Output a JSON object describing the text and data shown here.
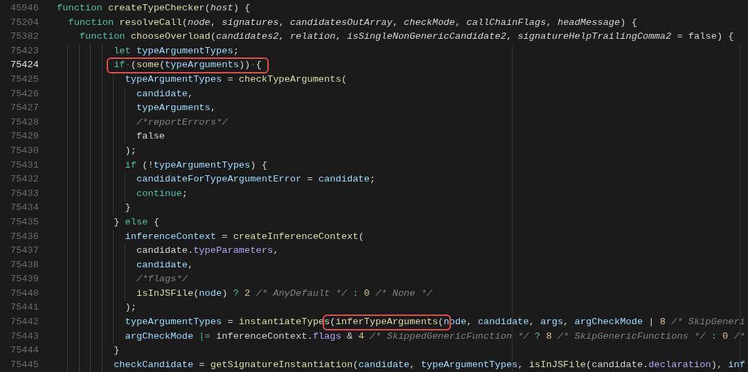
{
  "editor": {
    "lines": [
      {
        "number": "45946",
        "active": false,
        "sticky": true,
        "tokens": [
          {
            "kind": "kw",
            "text": "function "
          },
          {
            "kind": "fn",
            "text": "createTypeChecker"
          },
          {
            "kind": "plain",
            "text": "("
          },
          {
            "kind": "param",
            "text": "host"
          },
          {
            "kind": "plain",
            "text": ") {"
          }
        ]
      },
      {
        "number": "75204",
        "active": false,
        "sticky": true,
        "tokens": [
          {
            "kind": "kw",
            "text": "  function "
          },
          {
            "kind": "fn",
            "text": "resolveCall"
          },
          {
            "kind": "plain",
            "text": "("
          },
          {
            "kind": "param",
            "text": "node"
          },
          {
            "kind": "plain",
            "text": ", "
          },
          {
            "kind": "param",
            "text": "signatures"
          },
          {
            "kind": "plain",
            "text": ", "
          },
          {
            "kind": "param",
            "text": "candidatesOutArray"
          },
          {
            "kind": "plain",
            "text": ", "
          },
          {
            "kind": "param",
            "text": "checkMode"
          },
          {
            "kind": "plain",
            "text": ", "
          },
          {
            "kind": "param",
            "text": "callChainFlags"
          },
          {
            "kind": "plain",
            "text": ", "
          },
          {
            "kind": "param",
            "text": "headMessage"
          },
          {
            "kind": "plain",
            "text": ") {"
          }
        ]
      },
      {
        "number": "75382",
        "active": false,
        "sticky": true,
        "tokens": [
          {
            "kind": "kw",
            "text": "    function "
          },
          {
            "kind": "fn",
            "text": "chooseOverload"
          },
          {
            "kind": "plain",
            "text": "("
          },
          {
            "kind": "param",
            "text": "candidates2"
          },
          {
            "kind": "plain",
            "text": ", "
          },
          {
            "kind": "param",
            "text": "relation"
          },
          {
            "kind": "plain",
            "text": ", "
          },
          {
            "kind": "param",
            "text": "isSingleNonGenericCandidate2"
          },
          {
            "kind": "plain",
            "text": ", "
          },
          {
            "kind": "param",
            "text": "signatureHelpTrailingComma2"
          },
          {
            "kind": "plain",
            "text": " = false) {"
          }
        ]
      },
      {
        "number": "75423",
        "active": false,
        "sticky": false,
        "tokens": [
          {
            "kind": "kw",
            "text": "          let "
          },
          {
            "kind": "var",
            "text": "typeArgumentTypes"
          },
          {
            "kind": "plain",
            "text": ";"
          }
        ]
      },
      {
        "number": "75424",
        "active": true,
        "sticky": false,
        "tokens": [
          {
            "kind": "group",
            "boxed": true,
            "tokens": [
              {
                "kind": "kw",
                "text": "          if"
              },
              {
                "kind": "ws",
                "text": "·"
              },
              {
                "kind": "plain",
                "text": "("
              },
              {
                "kind": "fn",
                "text": "some"
              },
              {
                "kind": "plain",
                "text": "("
              },
              {
                "kind": "var",
                "text": "typeArguments"
              },
              {
                "kind": "plain",
                "text": "))"
              },
              {
                "kind": "ws",
                "text": "·"
              },
              {
                "kind": "plain",
                "text": "{"
              }
            ]
          }
        ]
      },
      {
        "number": "75425",
        "active": false,
        "sticky": false,
        "tokens": [
          {
            "kind": "var",
            "text": "            typeArgumentTypes"
          },
          {
            "kind": "plain",
            "text": " = "
          },
          {
            "kind": "fn",
            "text": "checkTypeArguments"
          },
          {
            "kind": "plain",
            "text": "("
          }
        ]
      },
      {
        "number": "75426",
        "active": false,
        "sticky": false,
        "tokens": [
          {
            "kind": "var",
            "text": "              candidate"
          },
          {
            "kind": "plain",
            "text": ","
          }
        ]
      },
      {
        "number": "75427",
        "active": false,
        "sticky": false,
        "tokens": [
          {
            "kind": "var",
            "text": "              typeArguments"
          },
          {
            "kind": "plain",
            "text": ","
          }
        ]
      },
      {
        "number": "75428",
        "active": false,
        "sticky": false,
        "tokens": [
          {
            "kind": "comment",
            "text": "              /*reportErrors*/"
          }
        ]
      },
      {
        "number": "75429",
        "active": false,
        "sticky": false,
        "tokens": [
          {
            "kind": "plain",
            "text": "              false"
          }
        ]
      },
      {
        "number": "75430",
        "active": false,
        "sticky": false,
        "tokens": [
          {
            "kind": "plain",
            "text": "            );"
          }
        ]
      },
      {
        "number": "75431",
        "active": false,
        "sticky": false,
        "tokens": [
          {
            "kind": "kw",
            "text": "            if"
          },
          {
            "kind": "plain",
            "text": " (!"
          },
          {
            "kind": "var",
            "text": "typeArgumentTypes"
          },
          {
            "kind": "plain",
            "text": ") {"
          }
        ]
      },
      {
        "number": "75432",
        "active": false,
        "sticky": false,
        "tokens": [
          {
            "kind": "var",
            "text": "              candidateForTypeArgumentError"
          },
          {
            "kind": "plain",
            "text": " = "
          },
          {
            "kind": "var",
            "text": "candidate"
          },
          {
            "kind": "plain",
            "text": ";"
          }
        ]
      },
      {
        "number": "75433",
        "active": false,
        "sticky": false,
        "tokens": [
          {
            "kind": "kw",
            "text": "              continue"
          },
          {
            "kind": "plain",
            "text": ";"
          }
        ]
      },
      {
        "number": "75434",
        "active": false,
        "sticky": false,
        "tokens": [
          {
            "kind": "plain",
            "text": "            }"
          }
        ]
      },
      {
        "number": "75435",
        "active": false,
        "sticky": false,
        "tokens": [
          {
            "kind": "plain",
            "text": "          } "
          },
          {
            "kind": "kw",
            "text": "else"
          },
          {
            "kind": "plain",
            "text": " {"
          }
        ]
      },
      {
        "number": "75436",
        "active": false,
        "sticky": false,
        "tokens": [
          {
            "kind": "var",
            "text": "            inferenceContext"
          },
          {
            "kind": "plain",
            "text": " = "
          },
          {
            "kind": "fn",
            "text": "createInferenceContext"
          },
          {
            "kind": "plain",
            "text": "("
          }
        ]
      },
      {
        "number": "75437",
        "active": false,
        "sticky": false,
        "tokens": [
          {
            "kind": "plain",
            "text": "              candidate."
          },
          {
            "kind": "prop",
            "text": "typeParameters"
          },
          {
            "kind": "plain",
            "text": ","
          }
        ]
      },
      {
        "number": "75438",
        "active": false,
        "sticky": false,
        "tokens": [
          {
            "kind": "var",
            "text": "              candidate"
          },
          {
            "kind": "plain",
            "text": ","
          }
        ]
      },
      {
        "number": "75439",
        "active": false,
        "sticky": false,
        "tokens": [
          {
            "kind": "comment",
            "text": "              /*flags*/"
          }
        ]
      },
      {
        "number": "75440",
        "active": false,
        "sticky": false,
        "tokens": [
          {
            "kind": "fn",
            "text": "              isInJSFile"
          },
          {
            "kind": "plain",
            "text": "("
          },
          {
            "kind": "var",
            "text": "node"
          },
          {
            "kind": "plain",
            "text": ")"
          },
          {
            "kind": "op",
            "text": " ? "
          },
          {
            "kind": "num",
            "text": "2"
          },
          {
            "kind": "comment",
            "text": " /* AnyDefault */ "
          },
          {
            "kind": "op",
            "text": ": "
          },
          {
            "kind": "num",
            "text": "0"
          },
          {
            "kind": "comment",
            "text": " /* None */"
          }
        ]
      },
      {
        "number": "75441",
        "active": false,
        "sticky": false,
        "tokens": [
          {
            "kind": "plain",
            "text": "            );"
          }
        ]
      },
      {
        "number": "75442",
        "active": false,
        "sticky": false,
        "tokens": [
          {
            "kind": "var",
            "text": "            typeArgumentTypes"
          },
          {
            "kind": "plain",
            "text": " = "
          },
          {
            "kind": "fn",
            "text": "instantiateTypes"
          },
          {
            "kind": "group",
            "boxed": true,
            "tokens": [
              {
                "kind": "plain",
                "text": "("
              },
              {
                "kind": "fn",
                "text": "inferTypeArguments"
              },
              {
                "kind": "plain",
                "text": "("
              }
            ]
          },
          {
            "kind": "var",
            "text": "node"
          },
          {
            "kind": "plain",
            "text": ", "
          },
          {
            "kind": "var",
            "text": "candidate"
          },
          {
            "kind": "plain",
            "text": ", "
          },
          {
            "kind": "var",
            "text": "args"
          },
          {
            "kind": "plain",
            "text": ", "
          },
          {
            "kind": "var",
            "text": "argCheckMode"
          },
          {
            "kind": "plain",
            "text": " | "
          },
          {
            "kind": "num",
            "text": "8"
          },
          {
            "kind": "comment",
            "text": " /* SkipGeneri"
          }
        ]
      },
      {
        "number": "75443",
        "active": false,
        "sticky": false,
        "tokens": [
          {
            "kind": "var",
            "text": "            argCheckMode"
          },
          {
            "kind": "op",
            "text": " |= "
          },
          {
            "kind": "plain",
            "text": "inferenceContext."
          },
          {
            "kind": "prop",
            "text": "flags"
          },
          {
            "kind": "plain",
            "text": " & "
          },
          {
            "kind": "num",
            "text": "4"
          },
          {
            "kind": "comment",
            "text": " /* SkippedGenericFunction */"
          },
          {
            "kind": "op",
            "text": " ? "
          },
          {
            "kind": "num",
            "text": "8"
          },
          {
            "kind": "comment",
            "text": " /* SkipGenericFunctions */"
          },
          {
            "kind": "op",
            "text": " : "
          },
          {
            "kind": "num",
            "text": "0"
          },
          {
            "kind": "comment",
            "text": " /*"
          }
        ]
      },
      {
        "number": "75444",
        "active": false,
        "sticky": false,
        "tokens": [
          {
            "kind": "plain",
            "text": "          }"
          }
        ]
      },
      {
        "number": "75445",
        "active": false,
        "sticky": false,
        "tokens": [
          {
            "kind": "var",
            "text": "          checkCandidate"
          },
          {
            "kind": "plain",
            "text": " = "
          },
          {
            "kind": "fn",
            "text": "getSignatureInstantiation"
          },
          {
            "kind": "plain",
            "text": "("
          },
          {
            "kind": "var",
            "text": "candidate"
          },
          {
            "kind": "plain",
            "text": ", "
          },
          {
            "kind": "var",
            "text": "typeArgumentTypes"
          },
          {
            "kind": "plain",
            "text": ", "
          },
          {
            "kind": "fn",
            "text": "isInJSFile"
          },
          {
            "kind": "plain",
            "text": "(candidate."
          },
          {
            "kind": "prop",
            "text": "declaration"
          },
          {
            "kind": "plain",
            "text": "), "
          },
          {
            "kind": "var",
            "text": "inf"
          }
        ]
      }
    ]
  }
}
